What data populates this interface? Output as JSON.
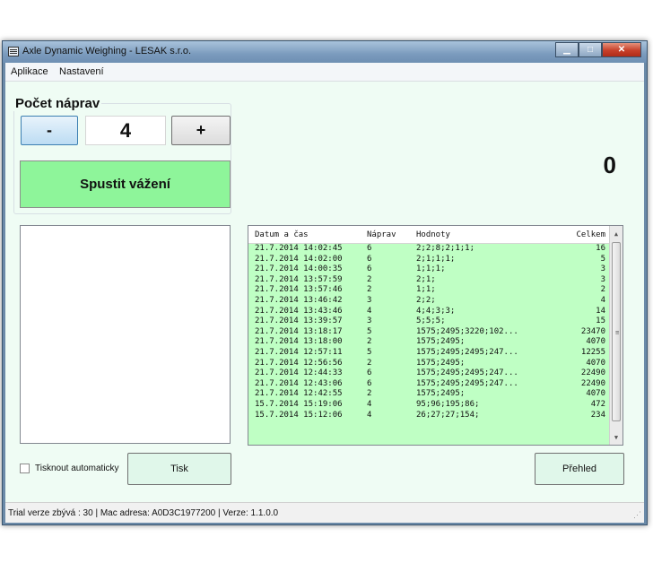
{
  "window": {
    "title": "Axle Dynamic Weighing - LESAK s.r.o."
  },
  "menu": {
    "items": [
      "Aplikace",
      "Nastavení"
    ]
  },
  "axles": {
    "label": "Počet náprav",
    "minus_label": "-",
    "value": "4",
    "plus_label": "+"
  },
  "start_label": "Spustit vážení",
  "weight_display": "0",
  "autoprint_label": "Tisknout automaticky",
  "print_label": "Tisk",
  "overview_label": "Přehled",
  "grid": {
    "columns": [
      "Datum a čas",
      "Náprav",
      "Hodnoty",
      "Celkem"
    ],
    "rows": [
      [
        "21.7.2014 14:02:45",
        "6",
        "2;2;8;2;1;1;",
        "16"
      ],
      [
        "21.7.2014 14:02:00",
        "6",
        "2;1;1;1;",
        "5"
      ],
      [
        "21.7.2014 14:00:35",
        "6",
        "1;1;1;",
        "3"
      ],
      [
        "21.7.2014 13:57:59",
        "2",
        "2;1;",
        "3"
      ],
      [
        "21.7.2014 13:57:46",
        "2",
        "1;1;",
        "2"
      ],
      [
        "21.7.2014 13:46:42",
        "3",
        "2;2;",
        "4"
      ],
      [
        "21.7.2014 13:43:46",
        "4",
        "4;4;3;3;",
        "14"
      ],
      [
        "21.7.2014 13:39:57",
        "3",
        "5;5;5;",
        "15"
      ],
      [
        "21.7.2014 13:18:17",
        "5",
        "1575;2495;3220;102...",
        "23470"
      ],
      [
        "21.7.2014 13:18:00",
        "2",
        "1575;2495;",
        "4070"
      ],
      [
        "21.7.2014 12:57:11",
        "5",
        "1575;2495;2495;247...",
        "12255"
      ],
      [
        "21.7.2014 12:56:56",
        "2",
        "1575;2495;",
        "4070"
      ],
      [
        "21.7.2014 12:44:33",
        "6",
        "1575;2495;2495;247...",
        "22490"
      ],
      [
        "21.7.2014 12:43:06",
        "6",
        "1575;2495;2495;247...",
        "22490"
      ],
      [
        "21.7.2014 12:42:55",
        "2",
        "1575;2495;",
        "4070"
      ],
      [
        "15.7.2014 15:19:06",
        "4",
        "95;96;195;86;",
        "472"
      ],
      [
        "15.7.2014 15:12:06",
        "4",
        "26;27;27;154;",
        "234"
      ]
    ]
  },
  "status": "Trial verze zbývá : 30  |  Mac adresa: A0D3C1977200  |  Verze: 1.1.0.0",
  "icons": {
    "app": "app-window-icon",
    "minimize": "minimize-icon",
    "maximize": "maximize-icon",
    "close": "close-icon"
  }
}
